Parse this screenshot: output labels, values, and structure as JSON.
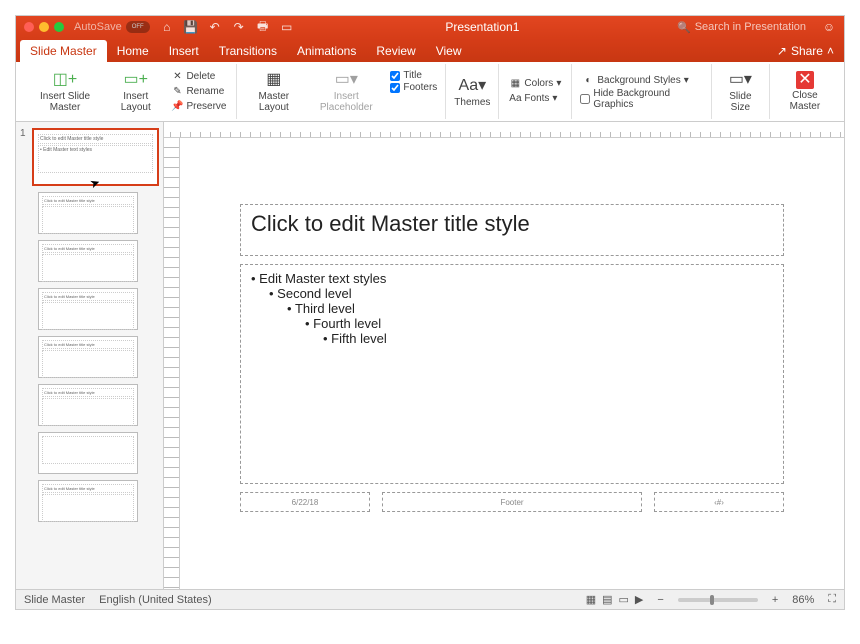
{
  "titlebar": {
    "autosave_label": "AutoSave",
    "autosave_state": "OFF",
    "title": "Presentation1",
    "search_placeholder": "Search in Presentation"
  },
  "tabs": {
    "slide_master": "Slide Master",
    "home": "Home",
    "insert": "Insert",
    "transitions": "Transitions",
    "animations": "Animations",
    "review": "Review",
    "view": "View",
    "share": "Share"
  },
  "ribbon": {
    "insert_slide_master": "Insert Slide\nMaster",
    "insert_layout": "Insert\nLayout",
    "delete": "Delete",
    "rename": "Rename",
    "preserve": "Preserve",
    "master_layout": "Master\nLayout",
    "insert_placeholder": "Insert\nPlaceholder",
    "title": "Title",
    "footers": "Footers",
    "themes": "Themes",
    "colors": "Colors",
    "fonts": "Fonts",
    "background_styles": "Background Styles",
    "hide_bg": "Hide Background Graphics",
    "slide_size": "Slide\nSize",
    "close_master": "Close\nMaster"
  },
  "thumbs": {
    "master_num": "1",
    "master_title": "Click to edit Master title style",
    "layout_title": "Click to edit Master title style"
  },
  "slide": {
    "title": "Click to edit Master title style",
    "l1": "Edit Master text styles",
    "l2": "Second level",
    "l3": "Third level",
    "l4": "Fourth level",
    "l5": "Fifth level",
    "date": "6/22/18",
    "footer": "Footer",
    "num": "‹#›"
  },
  "status": {
    "view": "Slide Master",
    "lang": "English (United States)",
    "zoom": "86%"
  }
}
